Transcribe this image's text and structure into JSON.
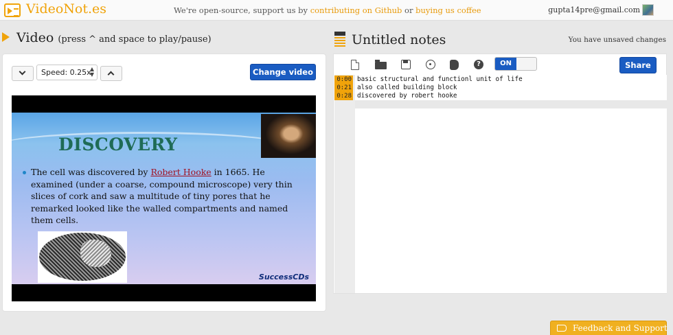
{
  "app": {
    "logo_text": "VideoNot.es",
    "promo": {
      "before": "We're open-source, support us by ",
      "github_link": "contributing on Github",
      "middle": " or ",
      "coffee_link": "buying us coffee"
    },
    "user_email": "gupta14pre@gmail.com"
  },
  "video": {
    "title": "Video",
    "subtitle": "(press ^ and space to play/pause)",
    "speed_label": "Speed: 0.25x",
    "change_video_label": "Change video",
    "slide": {
      "title": "DISCOVERY",
      "text_before": "The cell was discovered by ",
      "text_link": "Robert Hooke",
      "text_after": " in 1665. He examined (under a coarse, compound microscope) very thin slices of cork and saw a multitude of tiny pores that he remarked looked like the walled compartments and named them cells.",
      "brand": "SuccessCDs"
    }
  },
  "notes": {
    "title": "Untitled notes",
    "status": "You have unsaved changes",
    "toggle_label": "ON",
    "share_label": "Share",
    "help_glyph": "?",
    "lines": [
      {
        "time": "0:00",
        "text": "basic structural and functionl unit of life"
      },
      {
        "time": "0:21",
        "text": "also called building block"
      },
      {
        "time": "0:28",
        "text": "discovered by robert hooke"
      }
    ]
  },
  "feedback_label": "Feedback and Support",
  "colors": {
    "accent": "#f0a30a",
    "primary_button": "#1a5cc2",
    "timestamp_bg": "#f0a30a"
  },
  "icons": [
    "video-logo-icon",
    "play-icon",
    "chevron-down-icon",
    "chevron-up-icon",
    "notes-icon",
    "new-file-icon",
    "folder-open-icon",
    "save-icon",
    "sync-target-icon",
    "evernote-icon",
    "help-icon",
    "megaphone-icon"
  ]
}
